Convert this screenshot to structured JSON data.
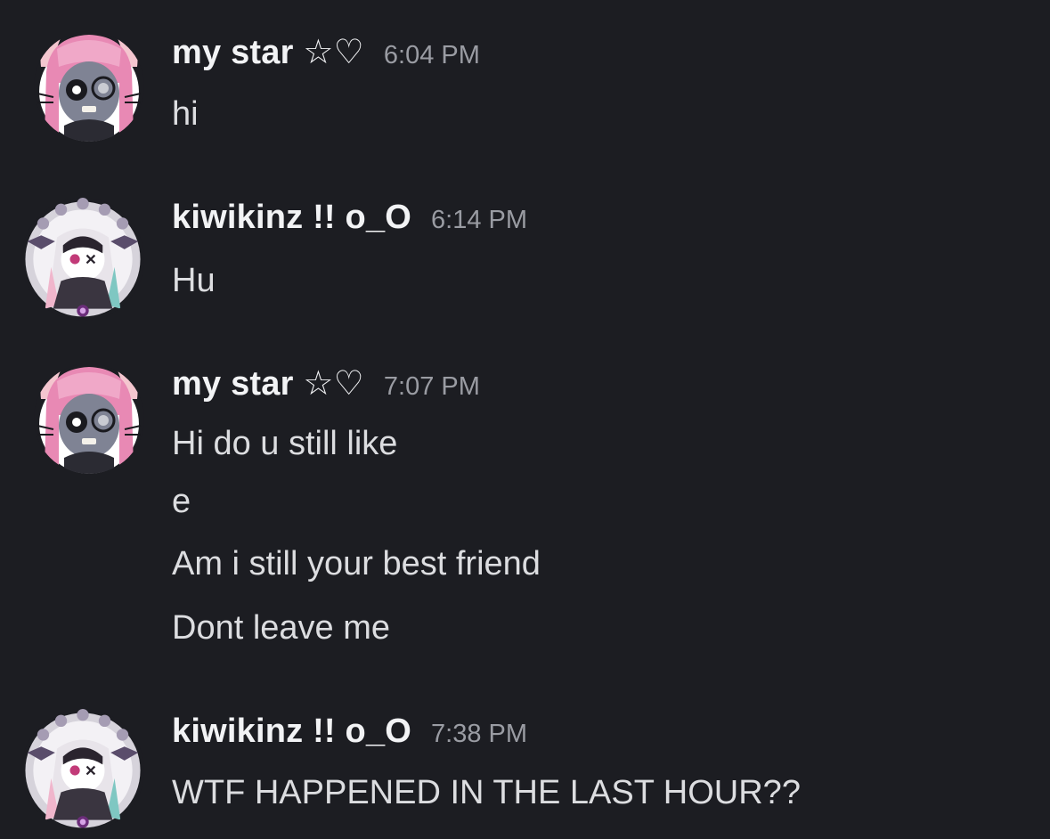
{
  "messages": [
    {
      "username": "my star ☆♡",
      "time": "6:04 PM",
      "avatar_icon": "pink-hair-cat-ear-girl-avatar",
      "lines": [
        "hi"
      ]
    },
    {
      "username": "kiwikinz !! o_O",
      "time": "6:14 PM",
      "avatar_icon": "lace-frame-gothic-girl-avatar",
      "lines": [
        "Hu"
      ]
    },
    {
      "username": "my star ☆♡",
      "time": "7:07 PM",
      "avatar_icon": "pink-hair-cat-ear-girl-avatar",
      "lines": [
        "Hi do u still like",
        "e",
        "Am i still your best friend",
        "Dont leave me"
      ]
    },
    {
      "username": "kiwikinz !! o_O",
      "time": "7:38 PM",
      "avatar_icon": "lace-frame-gothic-girl-avatar",
      "lines": [
        "WTF HAPPENED IN THE LAST HOUR??"
      ]
    }
  ],
  "colors": {
    "background": "#1c1d22",
    "username": "#f2f3f5",
    "timestamp": "#9a9ca3",
    "message_text": "#dcdde0"
  }
}
